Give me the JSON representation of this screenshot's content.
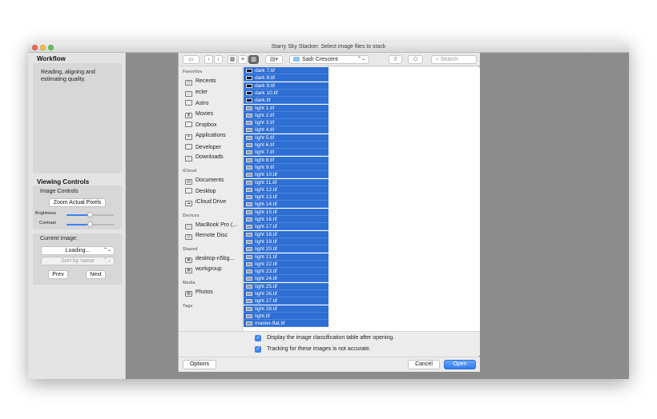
{
  "window": {
    "title": "Starry Sky Stacker: Select image files to stack"
  },
  "workflow": {
    "heading": "Workflow",
    "status": "Reading, aligning and estimating quality."
  },
  "viewing": {
    "heading": "Viewing Controls",
    "image_controls": "Image Controls",
    "zoom_button": "Zoom Actual Pixels",
    "brightness_label": "Brightness",
    "contrast_label": "Contrast",
    "brightness_level": 0.5,
    "contrast_level": 0.5
  },
  "current_image": {
    "label": "Current Image:",
    "loading": "Loading...",
    "sort": "Sort by name",
    "prev": "Prev",
    "next": "Next"
  },
  "toolbar": {
    "path": "Sadr Crescent",
    "search_placeholder": "Search"
  },
  "finder_sidebar": {
    "sections": [
      {
        "title": "Favorites",
        "items": [
          "Recents",
          "ecler",
          "Astro",
          "Movies",
          "Dropbox",
          "Applications",
          "Developer",
          "Downloads"
        ]
      },
      {
        "title": "iCloud",
        "items": [
          "Documents",
          "Desktop",
          "iCloud Drive"
        ]
      },
      {
        "title": "Devices",
        "items": [
          "MacBook Pro (...",
          "Remote Disc"
        ]
      },
      {
        "title": "Shared",
        "items": [
          "desktop-n5bg...",
          "workgroup"
        ]
      },
      {
        "title": "Media",
        "items": [
          "Photos"
        ]
      },
      {
        "title": "Tags",
        "items": []
      }
    ]
  },
  "files": [
    "dark 7.tif",
    "dark 8.tif",
    "dark 9.tif",
    "dark 10.tif",
    "dark.tif",
    "light 1.tif",
    "light 2.tif",
    "light 3.tif",
    "light 4.tif",
    "light 5.tif",
    "light 6.tif",
    "light 7.tif",
    "light 8.tif",
    "light 9.tif",
    "light 10.tif",
    "light 11.tif",
    "light 12.tif",
    "light 13.tif",
    "light 14.tif",
    "light 15.tif",
    "light 16.tif",
    "light 17.tif",
    "light 18.tif",
    "light 19.tif",
    "light 20.tif",
    "light 21.tif",
    "light 22.tif",
    "light 23.tif",
    "light 24.tif",
    "light 25.tif",
    "light 26.tif",
    "light 27.tif",
    "light 28.tif",
    "light.tif",
    "master-flat.tif"
  ],
  "options": {
    "check1": "Display the image classification table after opening.",
    "check2": "Tracking for these images is not accurate."
  },
  "footer": {
    "options": "Options",
    "cancel": "Cancel",
    "open": "Open"
  },
  "colors": {
    "selection": "#2f6ed3",
    "accent": "#3b82f6"
  }
}
